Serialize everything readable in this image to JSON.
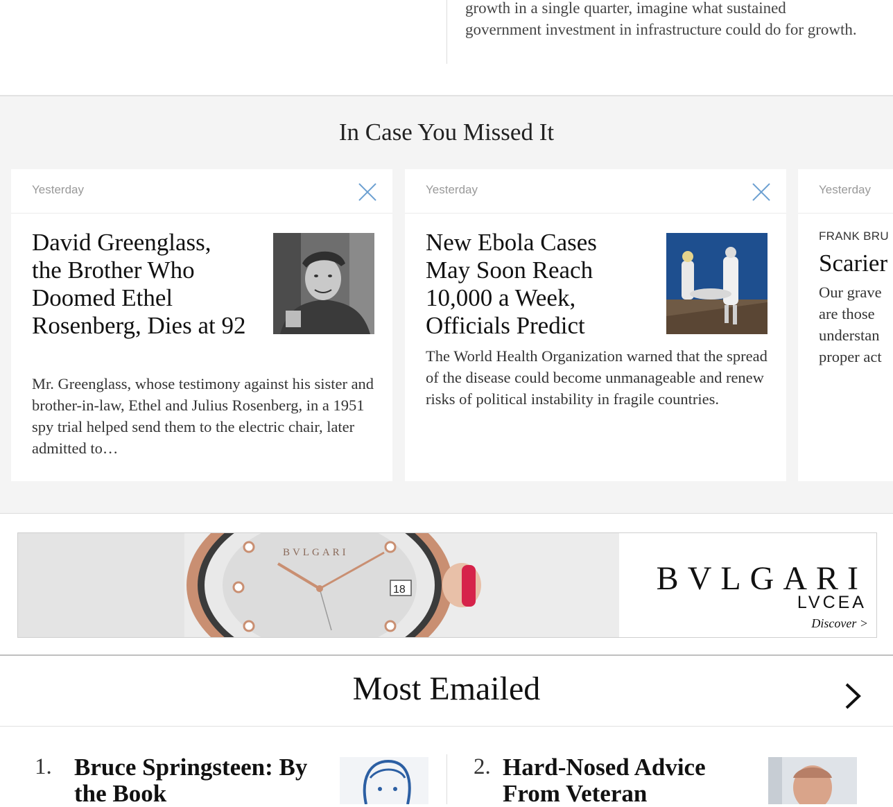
{
  "top_snippet": {
    "text": "growth in a single quarter, imagine what sustained government investment in infrastructure could do for growth."
  },
  "in_case_you_missed_it": {
    "title": "In Case You Missed It",
    "cards": [
      {
        "date": "Yesterday",
        "headline": "David Greenglass, the Brother Who Doomed Ethel Rosenberg, Dies at 92",
        "summary": "Mr. Greenglass, whose testimony against his sister and brother-in-law, Ethel and Julius Rosenberg, in a 1951 spy trial helped send them to the electric chair, later admitted to…",
        "image_icon": "portrait-photo-soldier"
      },
      {
        "date": "Yesterday",
        "headline": "New Ebola Cases May Soon Reach 10,000 a Week, Officials Predict",
        "summary": "The World Health Organization warned that the spread of the disease could become unmanageable and renew risks of political instability in fragile countries.",
        "image_icon": "photo-health-workers"
      },
      {
        "date": "Yesterday",
        "kicker": "FRANK BRU",
        "headline": "Scarier",
        "summary_lines": [
          "Our grave",
          "are those",
          "understan",
          "proper act"
        ]
      }
    ]
  },
  "ad": {
    "brand": "BVLGARI",
    "product": "LVCEA",
    "cta": "Discover >",
    "dial_brand": "BVLGARI",
    "dial_date": "18"
  },
  "most_emailed": {
    "title": "Most Emailed",
    "items": [
      {
        "rank": "1.",
        "headline": "Bruce Springsteen: By the Book"
      },
      {
        "rank": "2.",
        "headline": "Hard-Nosed Advice From Veteran"
      }
    ]
  },
  "colors": {
    "close_icon": "#6b9fd1",
    "section_bg": "#f4f4f4",
    "text_primary": "#111111"
  }
}
